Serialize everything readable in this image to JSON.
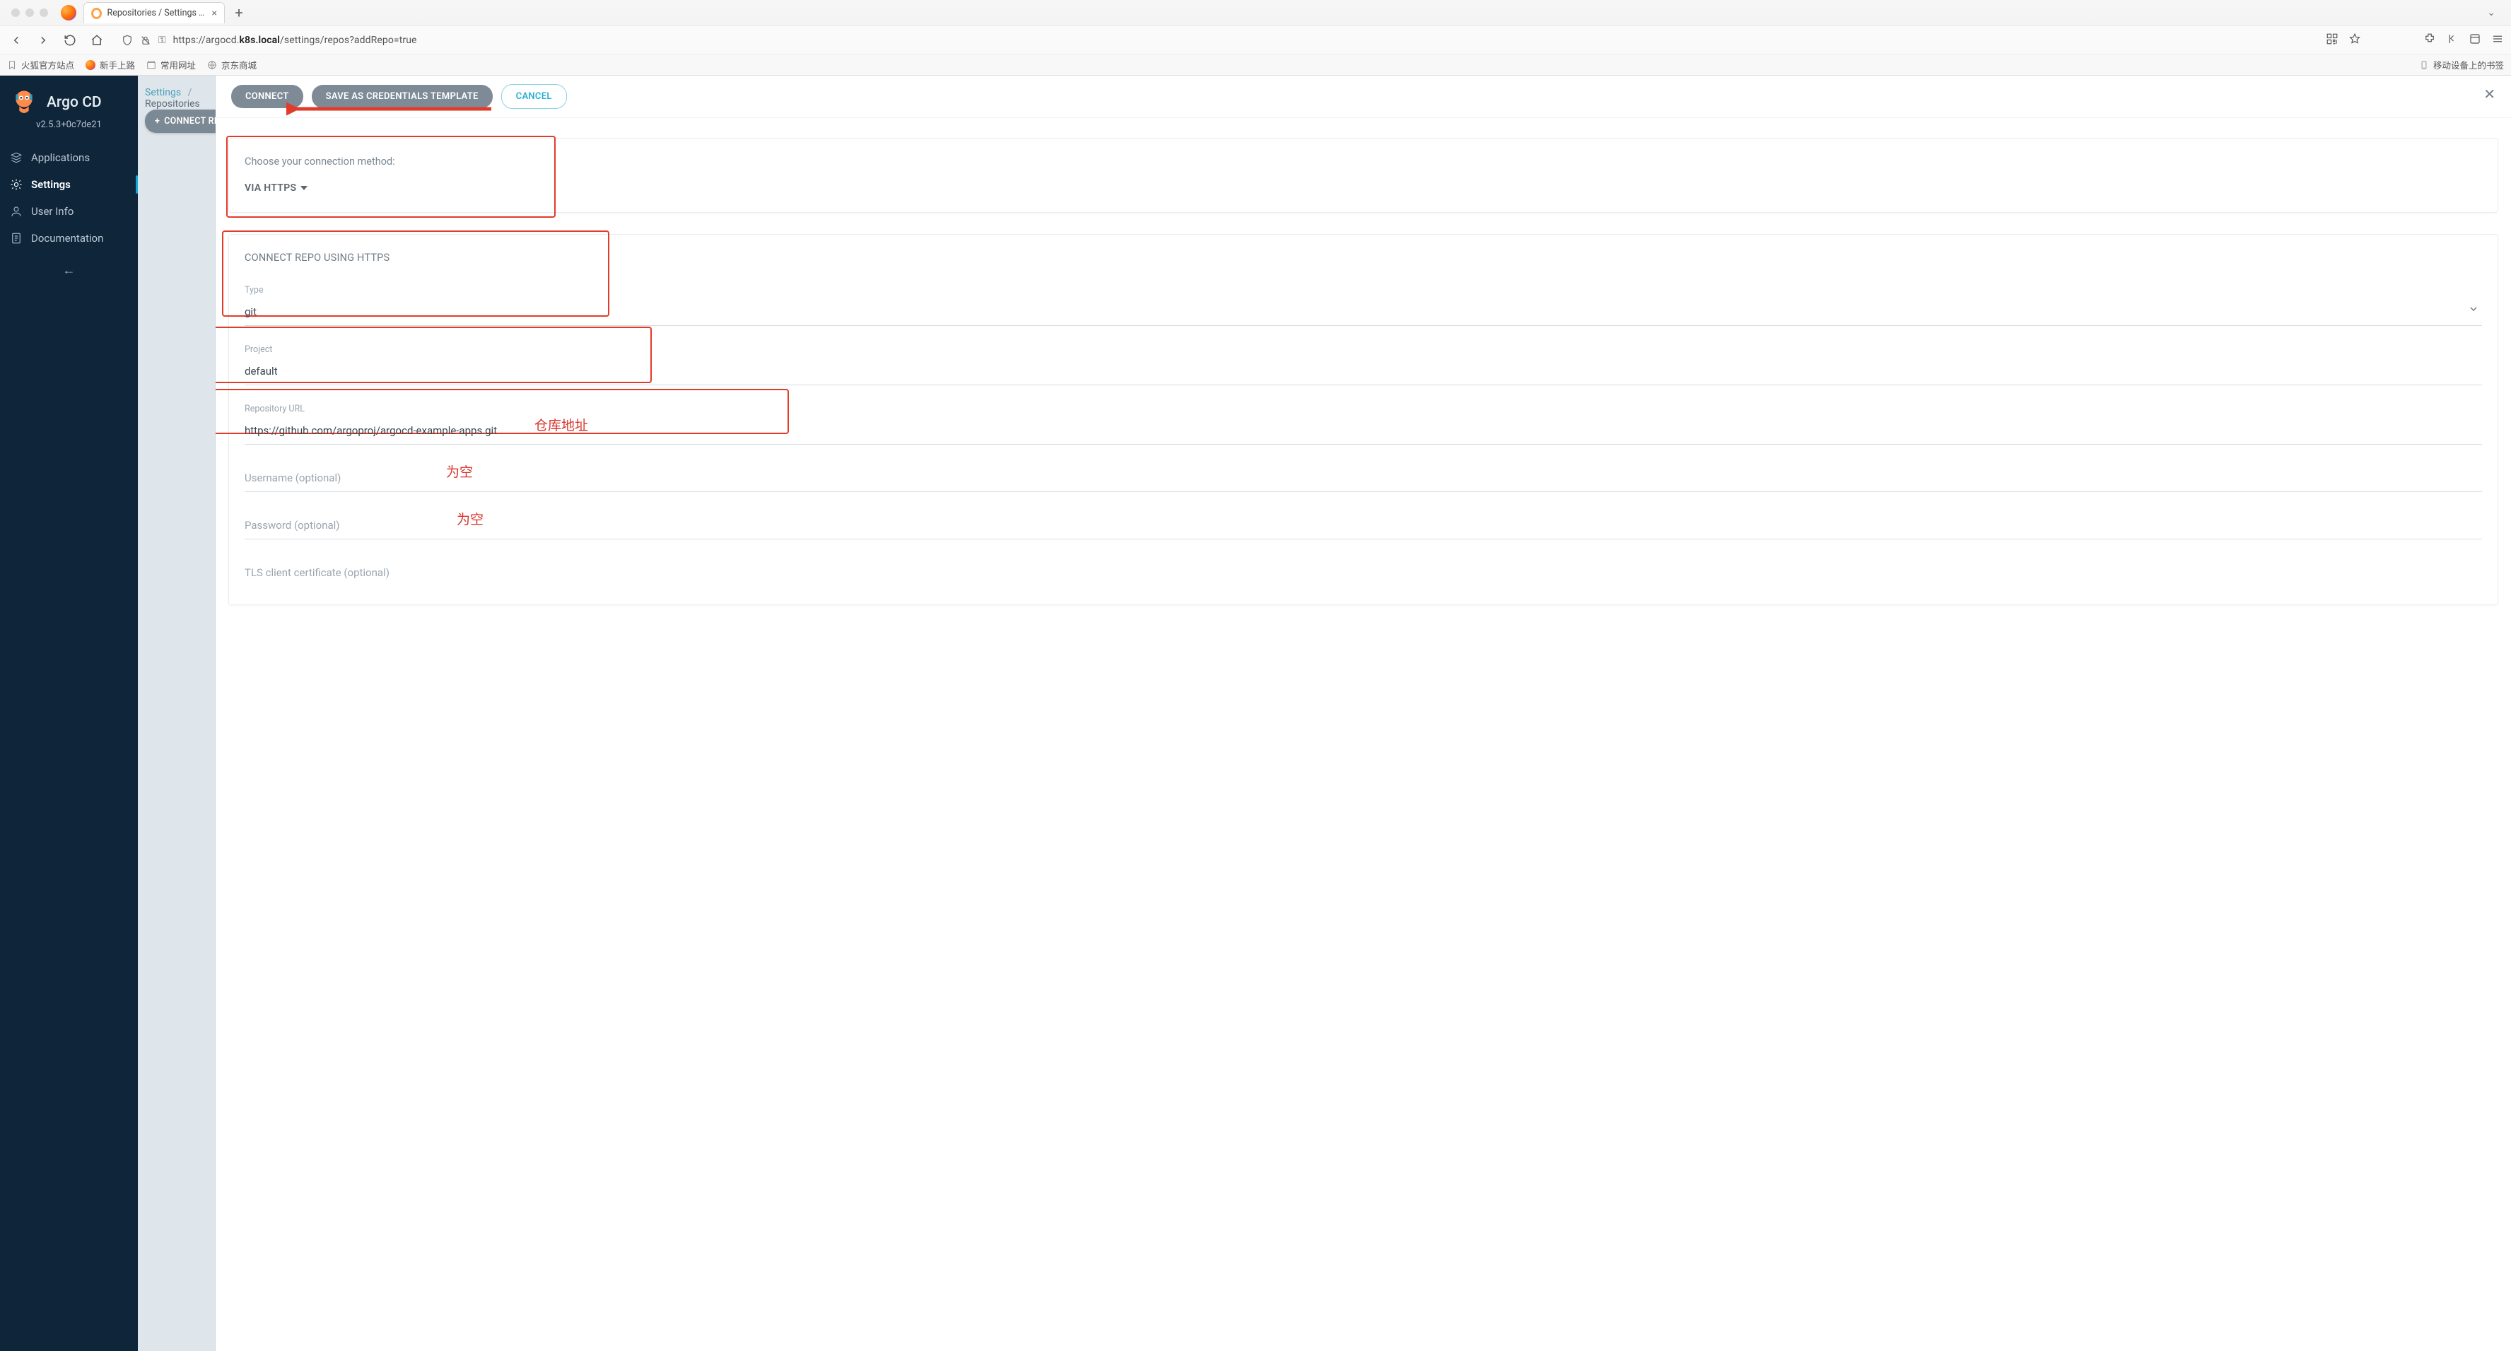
{
  "browser": {
    "tab_title": "Repositories / Settings - Argo C",
    "url_prefix": "https://argocd.",
    "url_host_bold": "k8s.local",
    "url_suffix": "/settings/repos?addRepo=true",
    "bookmarks": [
      "火狐官方站点",
      "新手上路",
      "常用网址",
      "京东商城"
    ],
    "bookmark_right": "移动设备上的书签"
  },
  "sidebar": {
    "title": "Argo CD",
    "version": "v2.5.3+0c7de21",
    "items": [
      {
        "label": "Applications"
      },
      {
        "label": "Settings"
      },
      {
        "label": "User Info"
      },
      {
        "label": "Documentation"
      }
    ]
  },
  "breadcrumb": {
    "a": "Settings",
    "b": "Repositories"
  },
  "strip_button": "CONNECT REPO",
  "panel": {
    "buttons": {
      "connect": "CONNECT",
      "save_tpl": "SAVE AS CREDENTIALS TEMPLATE",
      "cancel": "CANCEL"
    }
  },
  "method": {
    "label": "Choose your connection method:",
    "value": "VIA HTTPS"
  },
  "form": {
    "section": "CONNECT REPO USING HTTPS",
    "type_label": "Type",
    "type_value": "git",
    "project_label": "Project",
    "project_value": "default",
    "repo_label": "Repository URL",
    "repo_value": "https://github.com/argoproj/argocd-example-apps.git",
    "user_label": "Username (optional)",
    "user_value": "",
    "pass_label": "Password (optional)",
    "pass_value": "",
    "tls_label": "TLS client certificate (optional)"
  },
  "annotations": {
    "repo": "仓库地址",
    "empty1": "为空",
    "empty2": "为空"
  }
}
